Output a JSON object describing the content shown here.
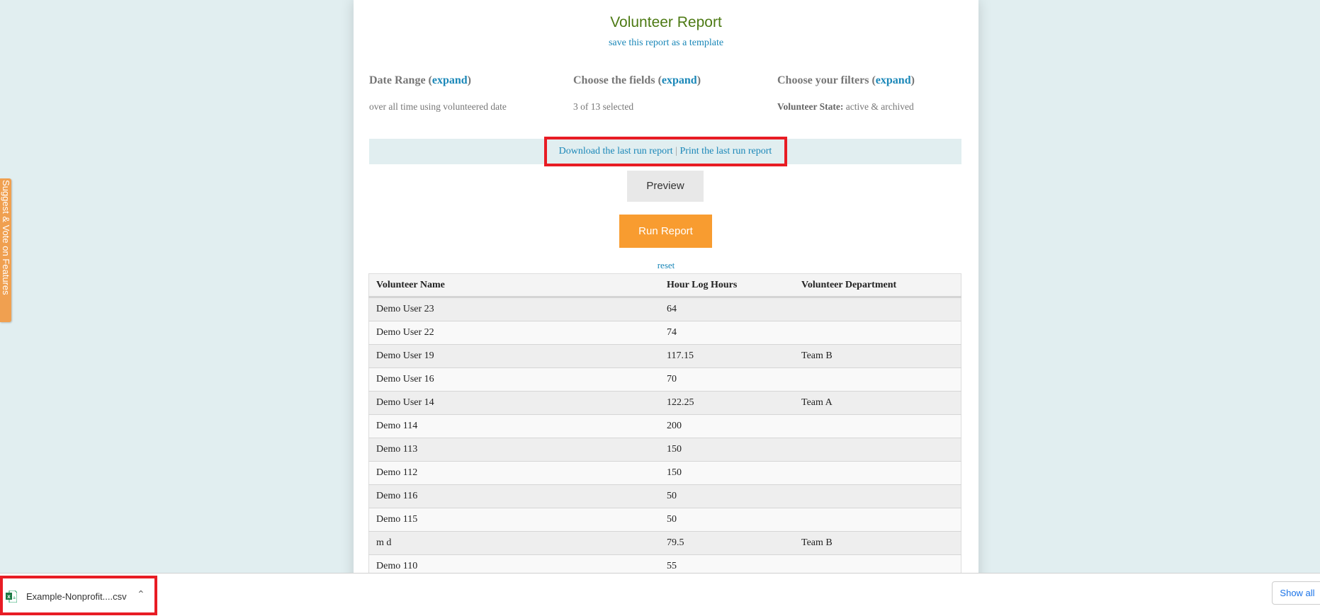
{
  "colors": {
    "accent_link": "#1a87b8",
    "run_button": "#f89c30",
    "title": "#4d7a14",
    "background": "#e1eef0",
    "highlight": "#e81c24"
  },
  "side_tab": {
    "label": "Suggest & Vote on Features"
  },
  "report": {
    "title": "Volunteer Report",
    "save_template": "save this report as a template",
    "sections": [
      {
        "heading": "Date Range",
        "link": "expand",
        "value": "over all time using volunteered date"
      },
      {
        "heading": "Choose the fields",
        "link": "expand",
        "value": "3 of 13 selected"
      },
      {
        "heading": "Choose your filters",
        "link": "expand",
        "value_label": "Volunteer State:",
        "value": "active & archived"
      }
    ],
    "download_link": "Download the last run report",
    "separator": "|",
    "print_link": "Print the last run report",
    "preview_label": "Preview",
    "run_label": "Run Report",
    "reset_label": "reset"
  },
  "table": {
    "headers": [
      "Volunteer Name",
      "Hour Log Hours",
      "Volunteer Department"
    ],
    "rows": [
      [
        "Demo User 23",
        "64",
        ""
      ],
      [
        "Demo User 22",
        "74",
        ""
      ],
      [
        "Demo User 19",
        "117.15",
        "Team B"
      ],
      [
        "Demo User 16",
        "70",
        ""
      ],
      [
        "Demo User 14",
        "122.25",
        "Team A"
      ],
      [
        "Demo 114",
        "200",
        ""
      ],
      [
        "Demo 113",
        "150",
        ""
      ],
      [
        "Demo 112",
        "150",
        ""
      ],
      [
        "Demo 116",
        "50",
        ""
      ],
      [
        "Demo 115",
        "50",
        ""
      ],
      [
        "m d",
        "79.5",
        "Team B"
      ],
      [
        "Demo 110",
        "55",
        ""
      ]
    ]
  },
  "download_shelf": {
    "file_name": "Example-Nonprofit....csv",
    "file_icon": "excel-icon",
    "chevron_icon": "chevron-up-icon",
    "show_all": "Show all"
  }
}
